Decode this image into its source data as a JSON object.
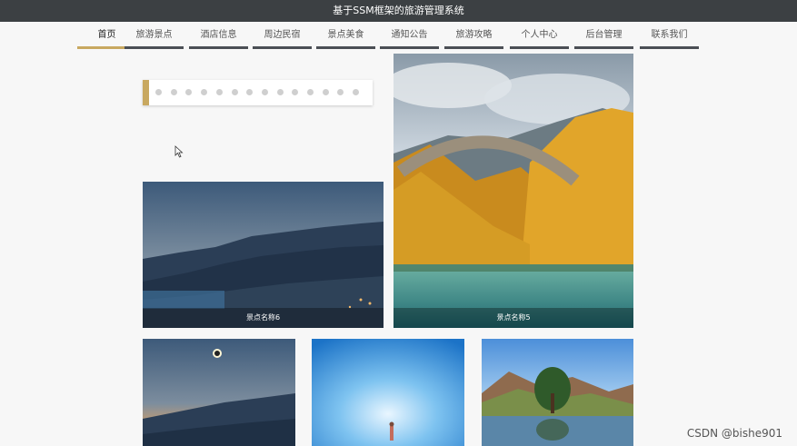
{
  "app": {
    "title": "基于SSM框架的旅游管理系统"
  },
  "nav": {
    "items": [
      {
        "label": "首页",
        "active": true
      },
      {
        "label": "旅游景点",
        "active": false
      },
      {
        "label": "酒店信息",
        "active": false
      },
      {
        "label": "周边民宿",
        "active": false
      },
      {
        "label": "景点美食",
        "active": false
      },
      {
        "label": "通知公告",
        "active": false
      },
      {
        "label": "旅游攻略",
        "active": false
      },
      {
        "label": "个人中心",
        "active": false
      },
      {
        "label": "后台管理",
        "active": false
      },
      {
        "label": "联系我们",
        "active": false
      }
    ]
  },
  "carousel": {
    "dot_count": 14
  },
  "cards": [
    {
      "caption": "景点名称6"
    },
    {
      "caption": "景点名称5"
    }
  ],
  "watermark": "CSDN @bishe901",
  "colors": {
    "accent": "#c8a860",
    "titlebar": "#3c4043"
  }
}
